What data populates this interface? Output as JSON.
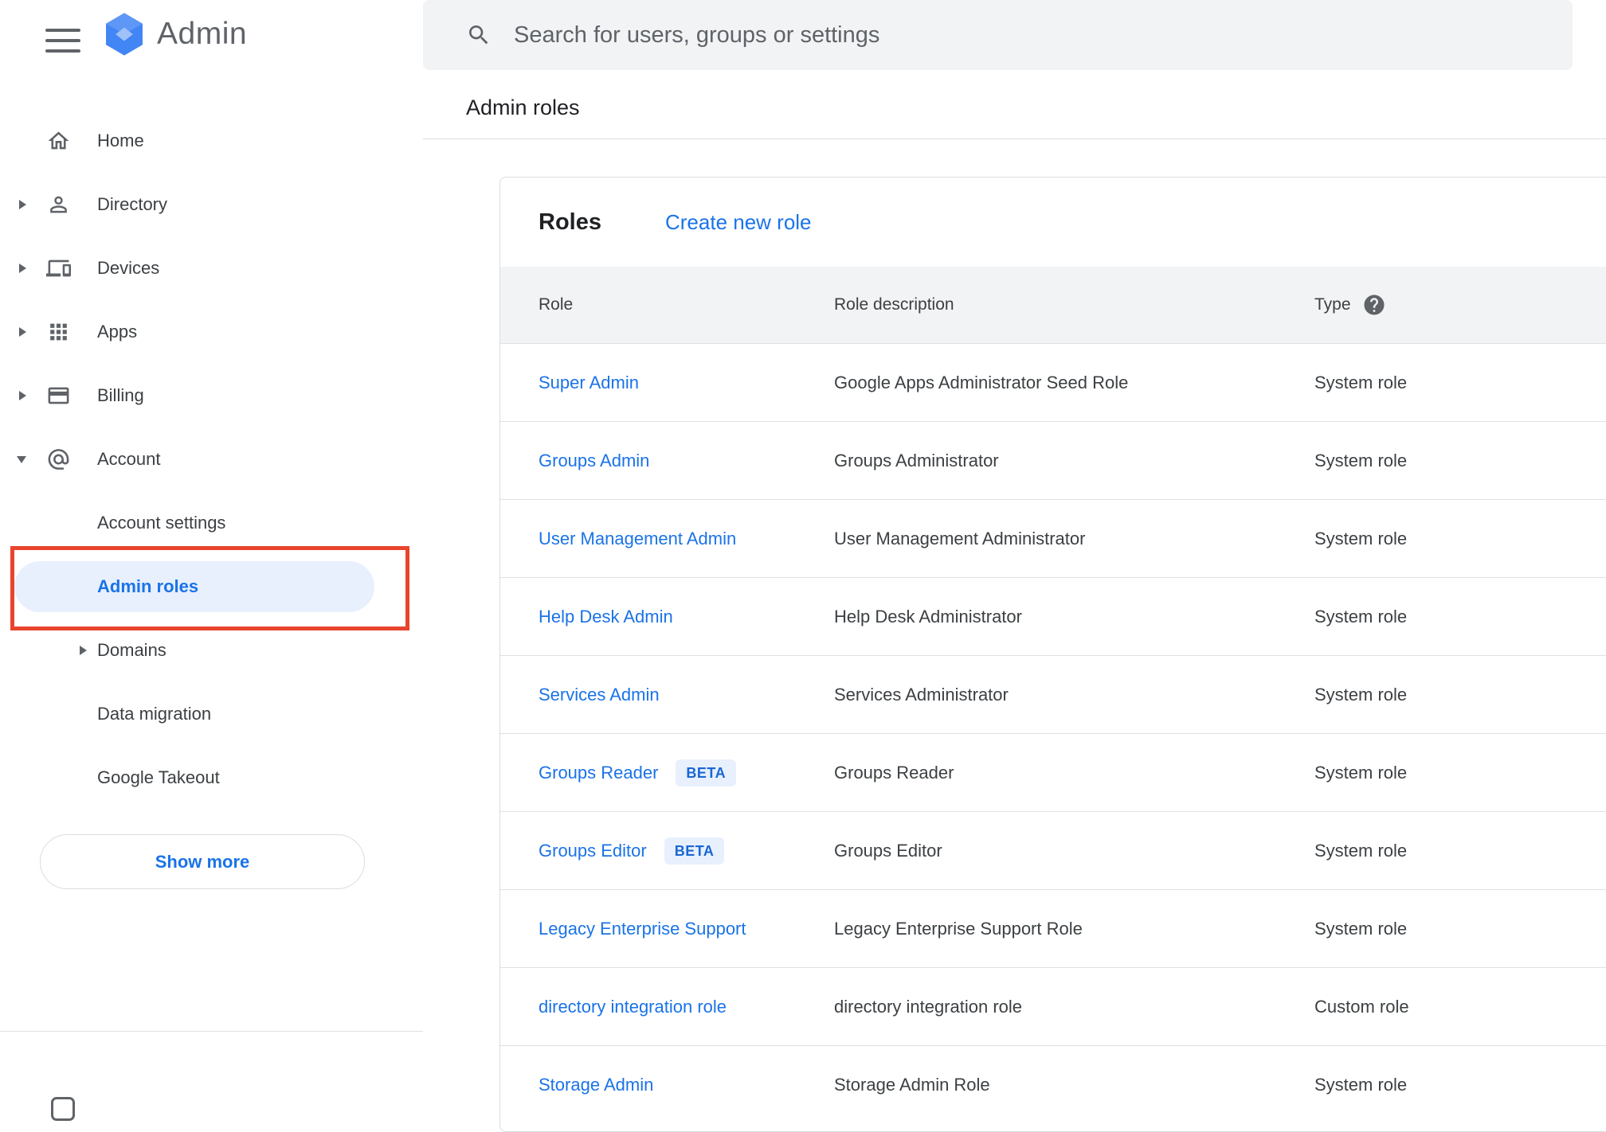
{
  "app": {
    "logo_text": "Admin"
  },
  "search": {
    "placeholder": "Search for users, groups or settings"
  },
  "breadcrumb": "Admin roles",
  "sidebar": {
    "items": [
      {
        "label": "Home"
      },
      {
        "label": "Directory"
      },
      {
        "label": "Devices"
      },
      {
        "label": "Apps"
      },
      {
        "label": "Billing"
      },
      {
        "label": "Account"
      },
      {
        "label": "Account settings"
      },
      {
        "label": "Admin roles"
      },
      {
        "label": "Domains"
      },
      {
        "label": "Data migration"
      },
      {
        "label": "Google Takeout"
      }
    ],
    "show_more": "Show more"
  },
  "roles": {
    "title": "Roles",
    "create_link": "Create new role",
    "columns": {
      "role": "Role",
      "description": "Role description",
      "type": "Type"
    },
    "rows": [
      {
        "role": "Super Admin",
        "description": "Google Apps Administrator Seed Role",
        "type": "System role"
      },
      {
        "role": "Groups Admin",
        "description": "Groups Administrator",
        "type": "System role"
      },
      {
        "role": "User Management Admin",
        "description": "User Management Administrator",
        "type": "System role"
      },
      {
        "role": "Help Desk Admin",
        "description": "Help Desk Administrator",
        "type": "System role"
      },
      {
        "role": "Services Admin",
        "description": "Services Administrator",
        "type": "System role"
      },
      {
        "role": "Groups Reader",
        "badge": "BETA",
        "description": "Groups Reader",
        "type": "System role"
      },
      {
        "role": "Groups Editor",
        "badge": "BETA",
        "description": "Groups Editor",
        "type": "System role"
      },
      {
        "role": "Legacy Enterprise Support",
        "description": "Legacy Enterprise Support Role",
        "type": "System role"
      },
      {
        "role": "directory integration role",
        "description": "directory integration role",
        "type": "Custom role"
      },
      {
        "role": "Storage Admin",
        "description": "Storage Admin Role",
        "type": "System role"
      }
    ]
  },
  "colors": {
    "accent_blue": "#1a73e8",
    "active_item_bg": "#e8f0fe",
    "annotation_red": "#e8442e",
    "table_header_bg": "#f1f3f4",
    "search_bg": "#f1f3f4",
    "beta_badge_bg": "#e8f0fe",
    "beta_badge_text": "#1967d2",
    "text_primary": "#202124",
    "text_secondary": "#3c4043",
    "icon_gray": "#5f6368"
  }
}
